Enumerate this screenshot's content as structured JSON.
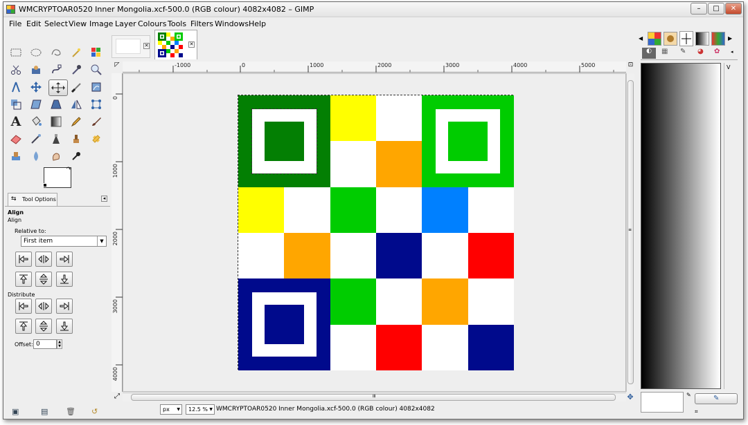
{
  "window": {
    "title": "WMCRYPTOAR0520 Inner Mongolia.xcf-500.0 (RGB colour) 4082x4082 – GIMP",
    "buttons": {
      "minimize": "–",
      "maximize": "□",
      "close": "✕"
    }
  },
  "menu": [
    "File",
    "Edit",
    "Select",
    "View",
    "Image",
    "Layer",
    "Colours",
    "Tools",
    "Filters",
    "Windows",
    "Help"
  ],
  "tool_options": {
    "tab_label": "Tool Options",
    "section_title": "Align",
    "subtitle": "Align",
    "relative_label": "Relative to:",
    "relative_value": "First item",
    "distribute_label": "Distribute",
    "offset_label": "Offset:",
    "offset_value": "0"
  },
  "rulers": {
    "horizontal": [
      "-1000",
      "0",
      "1000",
      "2000",
      "3000",
      "4000",
      "5000"
    ],
    "vertical": [
      "0",
      "1000",
      "2000",
      "3000",
      "4000"
    ]
  },
  "status": {
    "unit": "px",
    "zoom": "12.5 %",
    "text": "WMCRYPTOAR0520 Inner Mongolia.xcf-500.0 (RGB colour) 4082x4082"
  },
  "image_grid": {
    "colors": {
      "darkgreen": "#037f03",
      "green": "#00cc00",
      "yellow": "#ffff00",
      "orange": "#ffa600",
      "navy": "#000a8c",
      "blue": "#0080ff",
      "red": "#ff0000",
      "white": "#ffffff"
    },
    "rows": [
      [
        "darkgreen",
        "darkgreen",
        "yellow",
        "white",
        "green",
        "green"
      ],
      [
        "darkgreen",
        "darkgreen",
        "white",
        "orange",
        "green",
        "green"
      ],
      [
        "yellow",
        "white",
        "green",
        "white",
        "blue",
        "white"
      ],
      [
        "white",
        "orange",
        "white",
        "navy",
        "white",
        "red"
      ],
      [
        "navy",
        "navy",
        "green",
        "white",
        "orange",
        "white"
      ],
      [
        "navy",
        "navy",
        "white",
        "red",
        "white",
        "navy"
      ]
    ]
  }
}
